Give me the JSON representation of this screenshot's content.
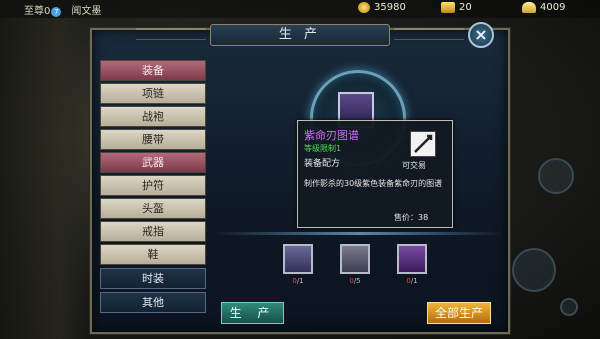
{
  "top": {
    "player_rank": "至尊0",
    "vip_level": "7",
    "player_name": "闻文墨",
    "coins": "35980",
    "gold": "20",
    "ingots": "4009"
  },
  "window": {
    "title": "生 产",
    "close_label": "×"
  },
  "categories": [
    {
      "label": "装备"
    },
    {
      "label": "项链"
    },
    {
      "label": "战袍"
    },
    {
      "label": "腰带"
    },
    {
      "label": "武器"
    },
    {
      "label": "护符"
    },
    {
      "label": "头盔"
    },
    {
      "label": "戒指"
    },
    {
      "label": "鞋"
    },
    {
      "label": "时装"
    },
    {
      "label": "其他"
    }
  ],
  "tooltip": {
    "name": "紫命刃图谱",
    "level_req": "等级限制1",
    "type": "装备配方",
    "tradable": "可交易",
    "description": "制作影杀的30级紫色装备紫命刃的图谱",
    "price": "售价：38"
  },
  "materials": [
    {
      "have": "0",
      "need": "/1"
    },
    {
      "have": "0",
      "need": "/5"
    },
    {
      "have": "0",
      "need": "/1"
    }
  ],
  "buttons": {
    "produce": "生 产",
    "produce_all": "全部生产"
  },
  "icons": [
    "vip-badge-icon",
    "coin-icon",
    "gold-icon",
    "ingot-icon",
    "close-icon",
    "recipe-scroll-icon",
    "dagger-material-icon",
    "ore-material-icon",
    "gem-material-icon"
  ]
}
